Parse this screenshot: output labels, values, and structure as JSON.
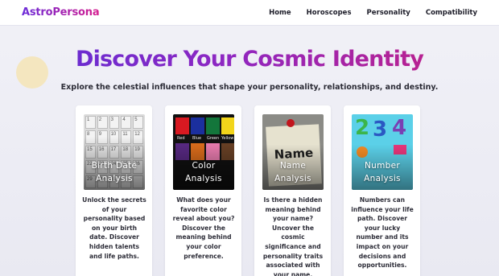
{
  "header": {
    "brand": "AstroPersona",
    "nav": [
      "Home",
      "Horoscopes",
      "Personality",
      "Compatibility"
    ]
  },
  "hero": {
    "title": "Discover Your Cosmic Identity",
    "subtitle": "Explore the celestial influences that shape your personality, relationships, and destiny."
  },
  "cards": [
    {
      "title_line1": "Birth Date",
      "title_line2": "Analysis",
      "desc": "Unlock the secrets of your personality based on your birth date. Discover hidden talents and life paths.",
      "image_icon": "calendar-image"
    },
    {
      "title_line1": "Color",
      "title_line2": "Analysis",
      "desc": "What does your favorite color reveal about you? Discover the meaning behind your color preference.",
      "image_icon": "color-swatches-image",
      "swatch_labels": [
        "Red",
        "Blue",
        "Green",
        "Yellow"
      ]
    },
    {
      "title_line1": "Name",
      "title_line2": "Analysis",
      "desc": "Is there a hidden meaning behind your name? Uncover the cosmic significance and personality traits associated with your name.",
      "image_icon": "pinned-note-image",
      "image_word": "Name"
    },
    {
      "title_line1": "Number",
      "title_line2": "Analysis",
      "desc": "Numbers can influence your life path. Discover your lucky number and its impact on your decisions and opportunities.",
      "image_icon": "colorful-numbers-image",
      "image_digits": [
        "2",
        "3",
        "4"
      ]
    }
  ],
  "colors": {
    "brand_start": "#6a2bd9",
    "brand_end": "#d61e8f",
    "background": "#ededf4",
    "card": "#ffffff"
  }
}
